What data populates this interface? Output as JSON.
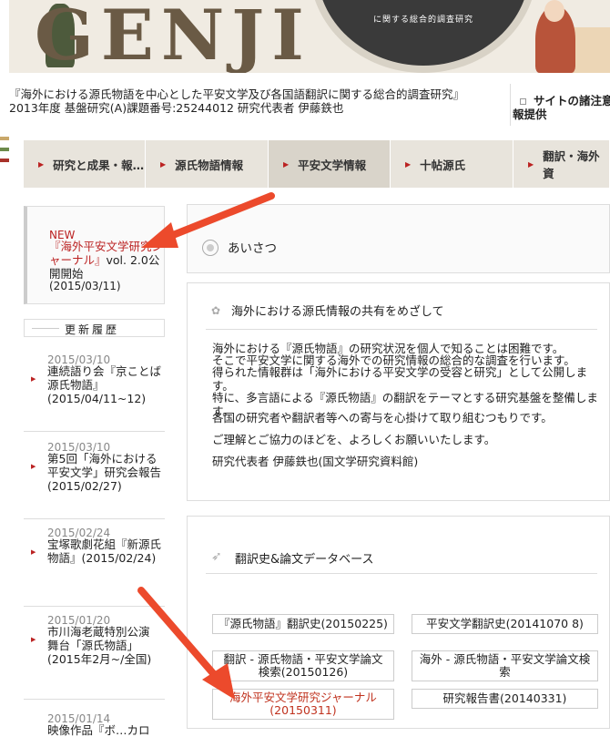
{
  "banner": {
    "logo_text": "GENJI",
    "ring_text": "に関する総合的調査研究"
  },
  "project": {
    "title_line1": "『海外における源氏物語を中心とした平安文学及び各国語翻訳に関する総合的調査研究』",
    "title_line2": "2013年度 基盤研究(A)課題番号:25244012 研究代表者 伊藤鉄也"
  },
  "right_links": {
    "line1": "サイトの諸注意",
    "line2": "報提供"
  },
  "nav": {
    "items": [
      {
        "label": "研究と成果・報…"
      },
      {
        "label": "源氏物語情報"
      },
      {
        "label": "平安文学情報"
      },
      {
        "label": "十帖源氏"
      },
      {
        "label": "翻訳・海外資"
      }
    ]
  },
  "sidebar": {
    "news": {
      "badge": "NEW",
      "link_red": "『海外平安文学研究ジャーナル』",
      "link_rest": "vol. 2.0公開開始",
      "date": "(2015/03/11)"
    },
    "history_heading": "更新履歴",
    "history": [
      {
        "date": "2015/03/10",
        "text": "連続語り会『京ことば 源氏物語』(2015/04/11~12)"
      },
      {
        "date": "2015/03/10",
        "text": "第5回「海外における平安文学」研究会報告(2015/02/27)"
      },
      {
        "date": "2015/02/24",
        "text": "宝塚歌劇花組『新源氏物語』(2015/02/24)"
      },
      {
        "date": "2015/01/20",
        "text": "市川海老蔵特別公演 舞台「源氏物語」(2015年2月~/全国)"
      },
      {
        "date": "2015/01/14",
        "text": "映像作品『ボ…カロ"
      }
    ]
  },
  "greeting": {
    "heading": "あいさつ",
    "subheading": "海外における源氏情報の共有をめざして",
    "paragraphs": [
      "海外における『源氏物語』の研究状況を個人で知ることは困難です。",
      "そこで平安文学に関する海外での研究情報の総合的な調査を行います。",
      "得られた情報群は「海外における平安文学の受容と研究」として公開します。",
      "特に、多言語による『源氏物語』の翻訳をテーマとする研究基盤を整備します。",
      "各国の研究者や翻訳者等への寄与を心掛けて取り組むつもりです。",
      "ご理解とご協力のほどを、よろしくお願いいたします。",
      "研究代表者 伊藤鉄也(国文学研究資料館)"
    ]
  },
  "database": {
    "heading": "翻訳史&論文データベース",
    "buttons": [
      {
        "label": "『源氏物語』翻訳史(20150225)"
      },
      {
        "label": "平安文学翻訳史(20141070 8)"
      },
      {
        "label": "翻訳 - 源氏物語・平安文学論文検索(20150126)"
      },
      {
        "label": "海外 - 源氏物語・平安文学論文検索"
      },
      {
        "label": "海外平安文学研究ジャーナル(20150311)"
      },
      {
        "label": "研究報告書(20140331)"
      }
    ]
  },
  "colors": {
    "accent_red": "#c0321e",
    "arrow": "#ec4a2c",
    "nav_bg": "#e8e4dc"
  }
}
